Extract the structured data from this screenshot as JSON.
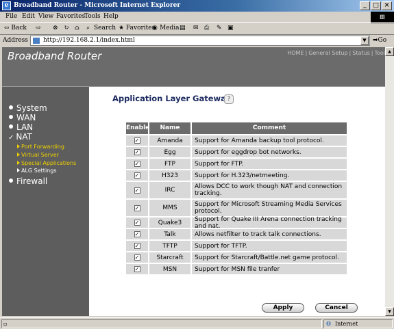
{
  "window": {
    "title": "Broadband Router - Microsoft Internet Explorer",
    "min": "_",
    "max": "□",
    "close": "×"
  },
  "menu": [
    "File",
    "Edit",
    "View",
    "Favorites",
    "Tools",
    "Help"
  ],
  "toolbar": {
    "back": "⇦ Back",
    "forward": "⇨",
    "stop": "⊗",
    "refresh": "↻",
    "home": "⌂",
    "search": "Search",
    "favorites": "Favorites",
    "media": "Media"
  },
  "address": {
    "label": "Address",
    "url": "http://192.168.2.1/index.html",
    "go": "Go"
  },
  "header": {
    "brand": "Broadband Router",
    "nav": [
      "HOME",
      "General Setup",
      "Status",
      "Tool"
    ]
  },
  "sidebar": {
    "items": [
      {
        "label": "System"
      },
      {
        "label": "WAN"
      },
      {
        "label": "LAN"
      },
      {
        "label": "NAT"
      },
      {
        "label": "Firewall"
      }
    ],
    "nat_check": "✓",
    "sub": [
      {
        "label": "Port Forwarding"
      },
      {
        "label": "Virtual Server"
      },
      {
        "label": "Special Applications"
      },
      {
        "label": "ALG Settings"
      }
    ]
  },
  "page": {
    "title": "Application Layer Gateway",
    "help": "?",
    "columns": [
      "Enable",
      "Name",
      "Comment"
    ],
    "check_mark": "✓",
    "rows": [
      {
        "enabled": true,
        "name": "Amanda",
        "comment": "Support for Amanda backup tool protocol."
      },
      {
        "enabled": true,
        "name": "Egg",
        "comment": "Support for eggdrop bot networks."
      },
      {
        "enabled": true,
        "name": "FTP",
        "comment": "Support for FTP."
      },
      {
        "enabled": true,
        "name": "H323",
        "comment": "Support for H.323/netmeeting."
      },
      {
        "enabled": true,
        "name": "IRC",
        "comment": "Allows DCC to work though NAT and connection tracking."
      },
      {
        "enabled": true,
        "name": "MMS",
        "comment": "Support for Microsoft Streaming Media Services protocol."
      },
      {
        "enabled": true,
        "name": "Quake3",
        "comment": "Support for Quake III Arena connection tracking and nat."
      },
      {
        "enabled": true,
        "name": "Talk",
        "comment": "Allows netfilter to track talk connections."
      },
      {
        "enabled": true,
        "name": "TFTP",
        "comment": "Support for TFTP."
      },
      {
        "enabled": true,
        "name": "Starcraft",
        "comment": "Support for Starcraft/Battle.net game protocol."
      },
      {
        "enabled": true,
        "name": "MSN",
        "comment": "Support for MSN file tranfer"
      }
    ],
    "apply": "Apply",
    "cancel": "Cancel"
  },
  "status": {
    "zone": "Internet"
  },
  "colors": {
    "header_bg": "#6b6b6b",
    "sidebar_bg": "#5c5d5c",
    "sub_link": "#f0d000",
    "title_text": "#1c2a60",
    "row_bg": "#d8d8d8"
  }
}
